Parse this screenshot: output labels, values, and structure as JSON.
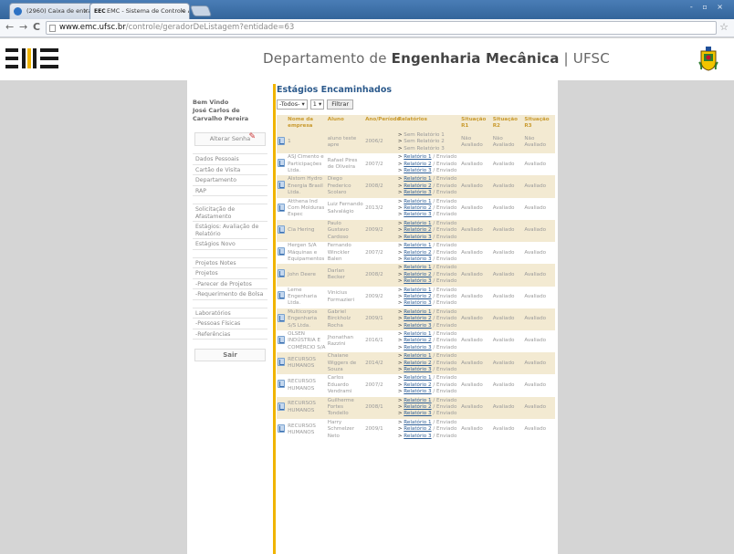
{
  "browser": {
    "tabs": [
      {
        "label": "(2960) Caixa de entrada",
        "close": "×"
      },
      {
        "label": "EMC - Sistema de Controle A",
        "favicon": "EEC",
        "close": "×"
      }
    ],
    "window_controls": "- ▫ ×",
    "back": "←",
    "forward": "→",
    "reload": "C",
    "url_host": "www.emc.ufsc.br",
    "url_path": "/controle/geradorDeListagem?entidade=63",
    "star": "☆"
  },
  "header": {
    "dept_pre": "Departamento de ",
    "dept_bold": "Engenharia Mecânica",
    "dept_sep": " | ",
    "dept_post": "UFSC"
  },
  "sidebar": {
    "welcome": "Bem Vindo",
    "user": "José Carlos de Carvalho Pereira",
    "change_password": "Alterar Senha",
    "groups": [
      [
        "Dados Pessoais",
        "Cartão de Visita",
        "Departamento",
        "RAP"
      ],
      [
        "Solicitação de Afastamento",
        "Estágios: Avaliação de Relatório",
        "Estágios Novo"
      ],
      [
        "Projetos Notes",
        "Projetos",
        "-Parecer de Projetos",
        "-Requerimento de Bolsa"
      ],
      [
        "Laboratórios",
        "-Pessoas Físicas",
        "-Referências"
      ]
    ],
    "logout": "Sair"
  },
  "main": {
    "title": "Estágios Encaminhados",
    "filter": {
      "select1": "-Todos- ▾",
      "select2": "1 ▾",
      "button": "Filtrar"
    },
    "columns": [
      "Nome da empresa",
      "Aluno",
      "Ano/Período",
      "Relatórios",
      "Situação R1",
      "Situação R2",
      "Situação R3"
    ],
    "report_labels": [
      "Relatório 1",
      "Relatório 2",
      "Relatório 3"
    ],
    "sent": "Enviado",
    "rows": [
      {
        "empresa": "1",
        "aluno": "aluno teste apre",
        "ano": "2006/2",
        "none": true,
        "r1": "Não Avaliado",
        "r2": "Não Avaliado",
        "r3": "Não Avaliado"
      },
      {
        "empresa": "ASJ Cimento e Participações Ltda.",
        "aluno": "Rafael Pires de Oliveira",
        "ano": "2007/2",
        "r1": "Avaliado",
        "r2": "Avaliado",
        "r3": "Avaliado"
      },
      {
        "empresa": "Alstom Hydro Energia Brasil Ltda.",
        "aluno": "Diego Frederico Scolaro",
        "ano": "2008/2",
        "r1": "Avaliado",
        "r2": "Avaliado",
        "r3": "Avaliado"
      },
      {
        "empresa": "Atthena Ind Com Molduras Espec",
        "aluno": "Luiz Fernando Salvalágio",
        "ano": "2013/2",
        "r1": "Avaliado",
        "r2": "Avaliado",
        "r3": "Avaliado"
      },
      {
        "empresa": "Cia Hering",
        "aluno": "Paulo Gustavo Cardoso",
        "ano": "2009/2",
        "r1": "Avaliado",
        "r2": "Avaliado",
        "r3": "Avaliado"
      },
      {
        "empresa": "Hergen S/A Máquinas e Equipamentos",
        "aluno": "Fernando Winckler Balen",
        "ano": "2007/2",
        "r1": "Avaliado",
        "r2": "Avaliado",
        "r3": "Avaliado"
      },
      {
        "empresa": "John Deere",
        "aluno": "Darlan Becker",
        "ano": "2008/2",
        "r1": "Avaliado",
        "r2": "Avaliado",
        "r3": "Avaliado"
      },
      {
        "empresa": "Leme Engenharia Ltda.",
        "aluno": "Vinicius Formazieri",
        "ano": "2009/2",
        "r1": "Avaliado",
        "r2": "Avaliado",
        "r3": "Avaliado"
      },
      {
        "empresa": "Multicorpos Engenharia S/S Ltda.",
        "aluno": "Gabriel Birckholz Rocha",
        "ano": "2009/1",
        "r1": "Avaliado",
        "r2": "Avaliado",
        "r3": "Avaliado"
      },
      {
        "empresa": "OLSEN INDÚSTRIA E COMÉRCIO S/A",
        "aluno": "Jhonathan Razzini",
        "ano": "2016/1",
        "r1": "Avaliado",
        "r2": "Avaliado",
        "r3": "Avaliado"
      },
      {
        "empresa": "RECURSOS HUMANOS",
        "aluno": "Chaiane Wiggers de Souza",
        "ano": "2014/2",
        "r1": "Avaliado",
        "r2": "Avaliado",
        "r3": "Avaliado"
      },
      {
        "empresa": "RECURSOS HUMANOS",
        "aluno": "Carlos Eduardo Vendrami",
        "ano": "2007/2",
        "r1": "Avaliado",
        "r2": "Avaliado",
        "r3": "Avaliado"
      },
      {
        "empresa": "RECURSOS HUMANOS",
        "aluno": "Guilherme Fortes Tondello",
        "ano": "2008/1",
        "r1": "Avaliado",
        "r2": "Avaliado",
        "r3": "Avaliado"
      },
      {
        "empresa": "RECURSOS HUMANOS",
        "aluno": "Harry Schmelzer Neto",
        "ano": "2009/1",
        "r1": "Avaliado",
        "r2": "Avaliado",
        "r3": "Avaliado"
      }
    ]
  },
  "colors": {
    "accent": "#f0b400",
    "link": "#2d5e96",
    "row_alt": "#f3ead2",
    "header_text": "#c99a2e",
    "title": "#2c5a8c"
  }
}
